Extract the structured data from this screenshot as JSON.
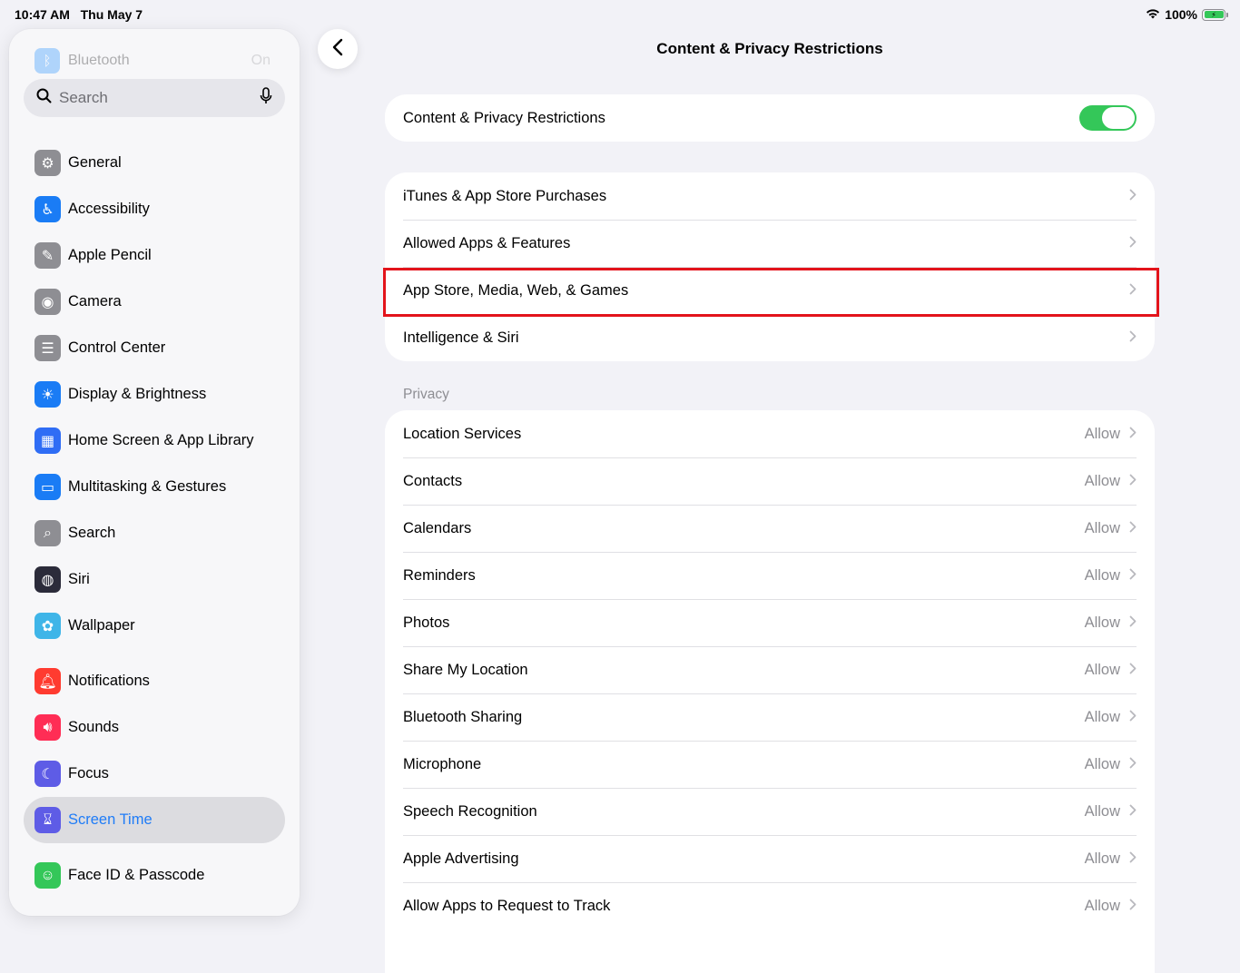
{
  "status": {
    "time": "10:47 AM",
    "date": "Thu May 7",
    "battery": "100%"
  },
  "sidebar": {
    "faded_item": {
      "label": "Bluetooth",
      "value": "On"
    },
    "search_placeholder": "Search",
    "items": [
      {
        "label": "General",
        "icon": "gear-icon",
        "color": "#8e8e93",
        "glyph": "⚙"
      },
      {
        "label": "Accessibility",
        "icon": "accessibility-icon",
        "color": "#1a7cf5",
        "glyph": "♿"
      },
      {
        "label": "Apple Pencil",
        "icon": "pencil-icon",
        "color": "#8e8e93",
        "glyph": "✎"
      },
      {
        "label": "Camera",
        "icon": "camera-icon",
        "color": "#8e8e93",
        "glyph": "◉"
      },
      {
        "label": "Control Center",
        "icon": "control-center-icon",
        "color": "#8e8e93",
        "glyph": "☰"
      },
      {
        "label": "Display & Brightness",
        "icon": "brightness-icon",
        "color": "#1a7cf5",
        "glyph": "☀"
      },
      {
        "label": "Home Screen & App Library",
        "icon": "home-screen-icon",
        "color": "#2f6df5",
        "glyph": "▦"
      },
      {
        "label": "Multitasking & Gestures",
        "icon": "multitasking-icon",
        "color": "#1a7cf5",
        "glyph": "▭"
      },
      {
        "label": "Search",
        "icon": "search-icon",
        "color": "#8e8e93",
        "glyph": "⌕"
      },
      {
        "label": "Siri",
        "icon": "siri-icon",
        "color": "#2b2b3a",
        "glyph": "◍"
      },
      {
        "label": "Wallpaper",
        "icon": "wallpaper-icon",
        "color": "#3fb5e8",
        "glyph": "✿"
      },
      {
        "label": "Notifications",
        "icon": "bell-icon",
        "color": "#ff3b30",
        "glyph": "🔔︎"
      },
      {
        "label": "Sounds",
        "icon": "speaker-icon",
        "color": "#ff2d55",
        "glyph": "🔊︎"
      },
      {
        "label": "Focus",
        "icon": "moon-icon",
        "color": "#5e5ce6",
        "glyph": "☾"
      },
      {
        "label": "Screen Time",
        "icon": "hourglass-icon",
        "color": "#5e5ce6",
        "glyph": "⌛︎"
      },
      {
        "label": "Face ID & Passcode",
        "icon": "face-id-icon",
        "color": "#34c759",
        "glyph": "☺"
      }
    ]
  },
  "page": {
    "title": "Content & Privacy Restrictions"
  },
  "main_toggle": {
    "label": "Content & Privacy Restrictions",
    "on": true
  },
  "restrictions": [
    "iTunes & App Store Purchases",
    "Allowed Apps & Features",
    "App Store, Media, Web, & Games",
    "Intelligence & Siri"
  ],
  "privacy": {
    "header": "Privacy",
    "items": [
      {
        "label": "Location Services",
        "value": "Allow"
      },
      {
        "label": "Contacts",
        "value": "Allow"
      },
      {
        "label": "Calendars",
        "value": "Allow"
      },
      {
        "label": "Reminders",
        "value": "Allow"
      },
      {
        "label": "Photos",
        "value": "Allow"
      },
      {
        "label": "Share My Location",
        "value": "Allow"
      },
      {
        "label": "Bluetooth Sharing",
        "value": "Allow"
      },
      {
        "label": "Microphone",
        "value": "Allow"
      },
      {
        "label": "Speech Recognition",
        "value": "Allow"
      },
      {
        "label": "Apple Advertising",
        "value": "Allow"
      },
      {
        "label": "Allow Apps to Request to Track",
        "value": "Allow"
      }
    ]
  },
  "colors": {
    "accent": "#1f7cf7",
    "toggle_on": "#34c759",
    "highlight": "#e3141b"
  }
}
